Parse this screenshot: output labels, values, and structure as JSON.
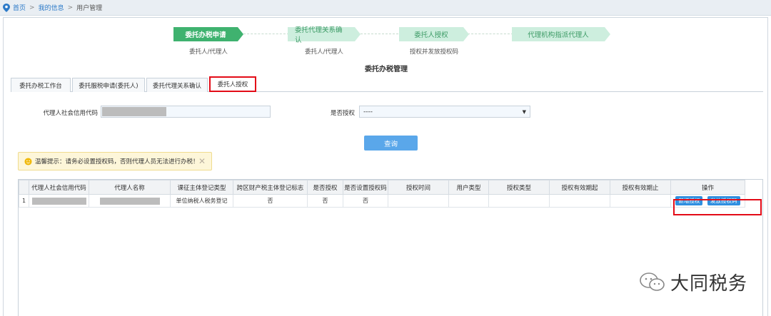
{
  "breadcrumb": {
    "home": "首页",
    "sep": ">",
    "my_info": "我的信息",
    "current": "用户管理"
  },
  "steps": [
    {
      "label": "委托办税申请",
      "sub": "委托人/代理人",
      "active": true
    },
    {
      "label": "委托代理关系确认",
      "sub": "委托人/代理人",
      "active": false
    },
    {
      "label": "委托人授权",
      "sub": "授权并发放授权码",
      "active": false
    },
    {
      "label": "代理机构指派代理人",
      "sub": "",
      "active": false
    }
  ],
  "page_title": "委托办税管理",
  "tabs": [
    {
      "label": "委托办税工作台"
    },
    {
      "label": "委托服税申请(委托人)"
    },
    {
      "label": "委托代理关系确认"
    },
    {
      "label": "委托人授权"
    }
  ],
  "form": {
    "credit_code_label": "代理人社会信用代码",
    "authorized_label": "是否授权",
    "authorized_value": "----",
    "query_label": "查询"
  },
  "tip": {
    "text": "温馨提示：请务必设置授权码，否则代理人员无法进行办税！",
    "close": "✕"
  },
  "table": {
    "headers": [
      "代理人社会信用代码",
      "代理人名称",
      "课征主体登记类型",
      "跨区财产税主体登记标志",
      "是否授权",
      "是否设置授权码",
      "授权时间",
      "用户类型",
      "授权类型",
      "授权有效期起",
      "授权有效期止",
      "操作"
    ],
    "rows": [
      {
        "num": "1",
        "reg_type": "单位纳税人税务登记",
        "cross_flag": "否",
        "authorized": "否",
        "code_set": "否"
      }
    ],
    "actions": {
      "add": "新增授权",
      "issue": "发放授权码"
    }
  },
  "watermark": {
    "text": "大同税务"
  }
}
